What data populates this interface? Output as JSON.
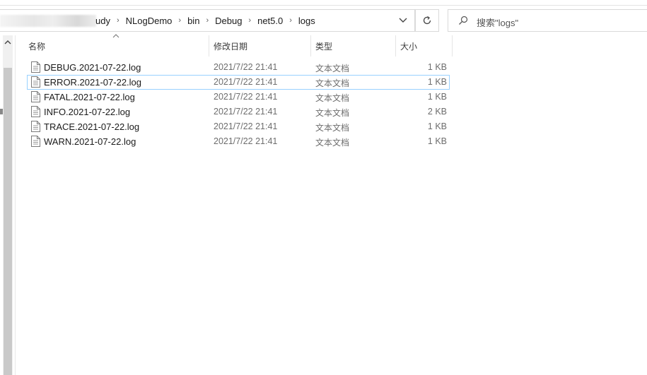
{
  "address": {
    "crumbs": [
      "udy",
      "NLogDemo",
      "bin",
      "Debug",
      "net5.0",
      "logs"
    ],
    "separator": "›"
  },
  "search": {
    "placeholder": "搜索\"logs\""
  },
  "columns": {
    "name": "名称",
    "date": "修改日期",
    "type": "类型",
    "size": "大小"
  },
  "files": [
    {
      "name": "DEBUG.2021-07-22.log",
      "date": "2021/7/22 21:41",
      "type": "文本文档",
      "size": "1 KB"
    },
    {
      "name": "ERROR.2021-07-22.log",
      "date": "2021/7/22 21:41",
      "type": "文本文档",
      "size": "1 KB"
    },
    {
      "name": "FATAL.2021-07-22.log",
      "date": "2021/7/22 21:41",
      "type": "文本文档",
      "size": "1 KB"
    },
    {
      "name": "INFO.2021-07-22.log",
      "date": "2021/7/22 21:41",
      "type": "文本文档",
      "size": "2 KB"
    },
    {
      "name": "TRACE.2021-07-22.log",
      "date": "2021/7/22 21:41",
      "type": "文本文档",
      "size": "1 KB"
    },
    {
      "name": "WARN.2021-07-22.log",
      "date": "2021/7/22 21:41",
      "type": "文本文档",
      "size": "1 KB"
    }
  ],
  "icons": {
    "dropdown": "chevron-down-icon",
    "refresh": "refresh-icon",
    "search": "search-icon",
    "sort": "sort-ascending-icon",
    "file": "text-file-icon",
    "scroll_up": "scroll-up-icon"
  },
  "colors": {
    "focus_outline": "#99d1ff",
    "secondary_text": "#6d6d6d"
  }
}
